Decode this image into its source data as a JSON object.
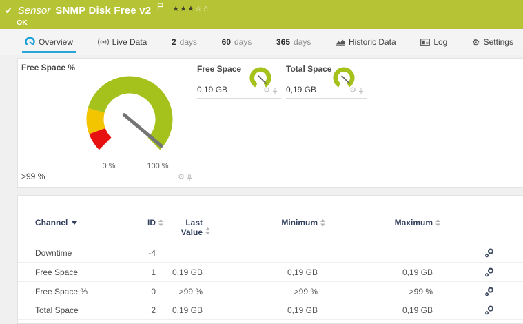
{
  "colors": {
    "status_green": "#b5c334",
    "accent_blue": "#29a5da",
    "gauge_green": "#a5c21c",
    "gauge_yellow": "#f2c500",
    "gauge_red": "#e81111",
    "table_header_navy": "#32405e"
  },
  "header": {
    "type_label": "Sensor",
    "title": "SNMP Disk Free v2",
    "status": "OK",
    "rating": {
      "filled_stars": "★★★",
      "empty_stars": "☆☆",
      "filled": 3,
      "total": 5
    }
  },
  "tabs": {
    "overview": "Overview",
    "live_data": "Live Data",
    "d2_num": "2",
    "d2_label": "days",
    "d60_num": "60",
    "d60_label": "days",
    "d365_num": "365",
    "d365_label": "days",
    "historic": "Historic Data",
    "log": "Log",
    "settings": "Settings"
  },
  "gauges": {
    "free_space_pct": {
      "title": "Free Space %",
      "value": ">99 %",
      "scale_min": "0 %",
      "scale_max": "100 %",
      "percent": 99,
      "zones": [
        {
          "color": "red",
          "from_pct": 0,
          "to_pct": 9
        },
        {
          "color": "yellow",
          "from_pct": 9,
          "to_pct": 22
        },
        {
          "color": "green",
          "from_pct": 22,
          "to_pct": 100
        }
      ]
    },
    "free_space": {
      "title": "Free Space",
      "value": "0,19 GB",
      "percent": 100
    },
    "total_space": {
      "title": "Total Space",
      "value": "0,19 GB",
      "percent": 100
    }
  },
  "table": {
    "headers": {
      "channel": "Channel",
      "id": "ID",
      "last_value": "Last Value",
      "minimum": "Minimum",
      "maximum": "Maximum"
    },
    "rows": [
      {
        "channel": "Downtime",
        "id": "-4",
        "last": "",
        "min": "",
        "max": ""
      },
      {
        "channel": "Free Space",
        "id": "1",
        "last": "0,19 GB",
        "min": "0,19 GB",
        "max": "0,19 GB"
      },
      {
        "channel": "Free Space %",
        "id": "0",
        "last": ">99 %",
        "min": ">99 %",
        "max": ">99 %"
      },
      {
        "channel": "Total Space",
        "id": "2",
        "last": "0,19 GB",
        "min": "0,19 GB",
        "max": "0,19 GB"
      }
    ]
  }
}
